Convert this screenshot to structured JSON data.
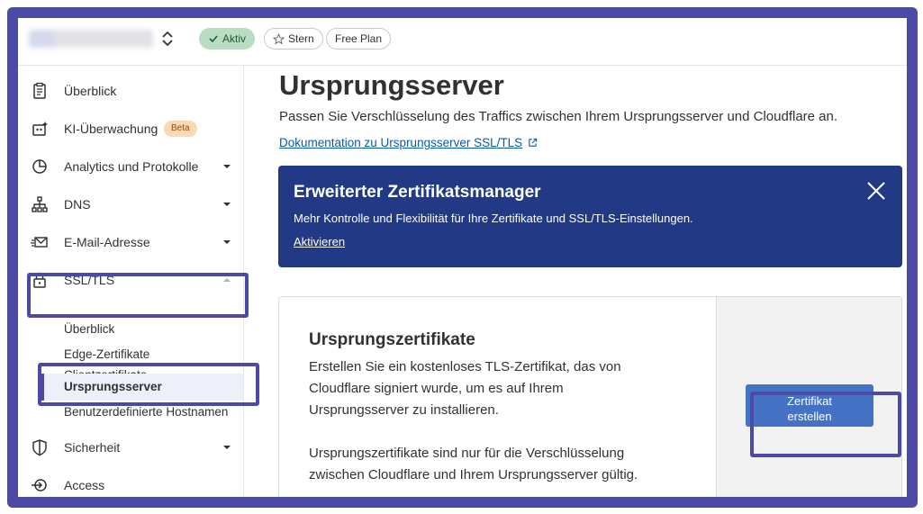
{
  "topbar": {
    "domain_label": "",
    "status_pill": "Aktiv",
    "star_pill": "Stern",
    "plan_pill": "Free Plan"
  },
  "sidebar": {
    "items": [
      {
        "label": "Überblick",
        "icon": "clipboard-icon"
      },
      {
        "label": "KI-Überwachung",
        "icon": "robot-icon",
        "badge": "Beta"
      },
      {
        "label": "Analytics und Protokolle",
        "icon": "chart-pie-icon"
      },
      {
        "label": "DNS",
        "icon": "network-icon"
      },
      {
        "label": "E-Mail-Adresse",
        "icon": "email-icon"
      },
      {
        "label": "SSL/TLS",
        "icon": "lock-icon"
      },
      {
        "label": "Sicherheit",
        "icon": "shield-icon"
      },
      {
        "label": "Access",
        "icon": "access-icon"
      }
    ],
    "ssl_sub_items": [
      "Überblick",
      "Edge-Zertifikate",
      "Clientzertifikate",
      "Ursprungsserver",
      "Benutzerdefinierte Hostnamen"
    ]
  },
  "main": {
    "title": "Ursprungsserver",
    "description": "Passen Sie Verschlüsselung des Traffics zwischen Ihrem Ursprungsserver und Cloudflare an.",
    "doc_link": "Dokumentation zu Ursprungsserver SSL/TLS",
    "banner": {
      "title": "Erweiterter Zertifikatsmanager",
      "text": "Mehr Kontrolle und Flexibilität für Ihre Zertifikate und SSL/TLS-Einstellungen.",
      "link": "Aktivieren"
    },
    "card": {
      "title": "Ursprungszertifikate",
      "p1_l1": "Erstellen Sie ein kostenloses TLS-Zertifikat, das von",
      "p1_l2": "Cloudflare signiert wurde, um es auf Ihrem",
      "p1_l3": "Ursprungsserver zu installieren.",
      "p2_l1": "Ursprungszertifikate sind nur für die Verschlüsselung",
      "p2_l2": "zwischen Cloudflare und Ihrem Ursprungsserver gültig.",
      "button_l1": "Zertifikat",
      "button_l2": "erstellen"
    }
  },
  "colors": {
    "highlight": "#4d4aa6",
    "banner_bg": "#223a86",
    "button_bg": "#4472c4",
    "link": "#0a5ba7",
    "active_pill": "#b9dcc2"
  }
}
